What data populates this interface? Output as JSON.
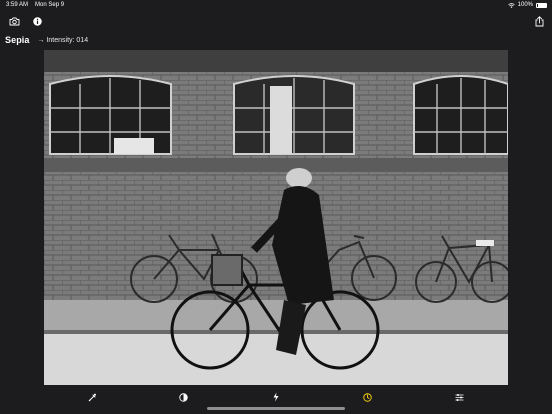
{
  "status_bar": {
    "time": "3:59 AM",
    "date": "Mon Sep 9",
    "battery": "100%",
    "battery_level": 1.0
  },
  "toolbar": {
    "left_icons": [
      "camera-icon",
      "info-icon"
    ],
    "right_icons": [
      "share-icon"
    ]
  },
  "filter": {
    "name": "Sepia",
    "value_text": "→ Intensity: 014"
  },
  "bottom_toolbar": {
    "icons": [
      "eyedropper-icon",
      "contrast-icon",
      "lightning-icon",
      "filter-wheel-icon",
      "sliders-icon"
    ],
    "active_icon": "filter-wheel-icon"
  },
  "colors": {
    "background": "#1c1c1e",
    "accent": "#ffd60a"
  }
}
